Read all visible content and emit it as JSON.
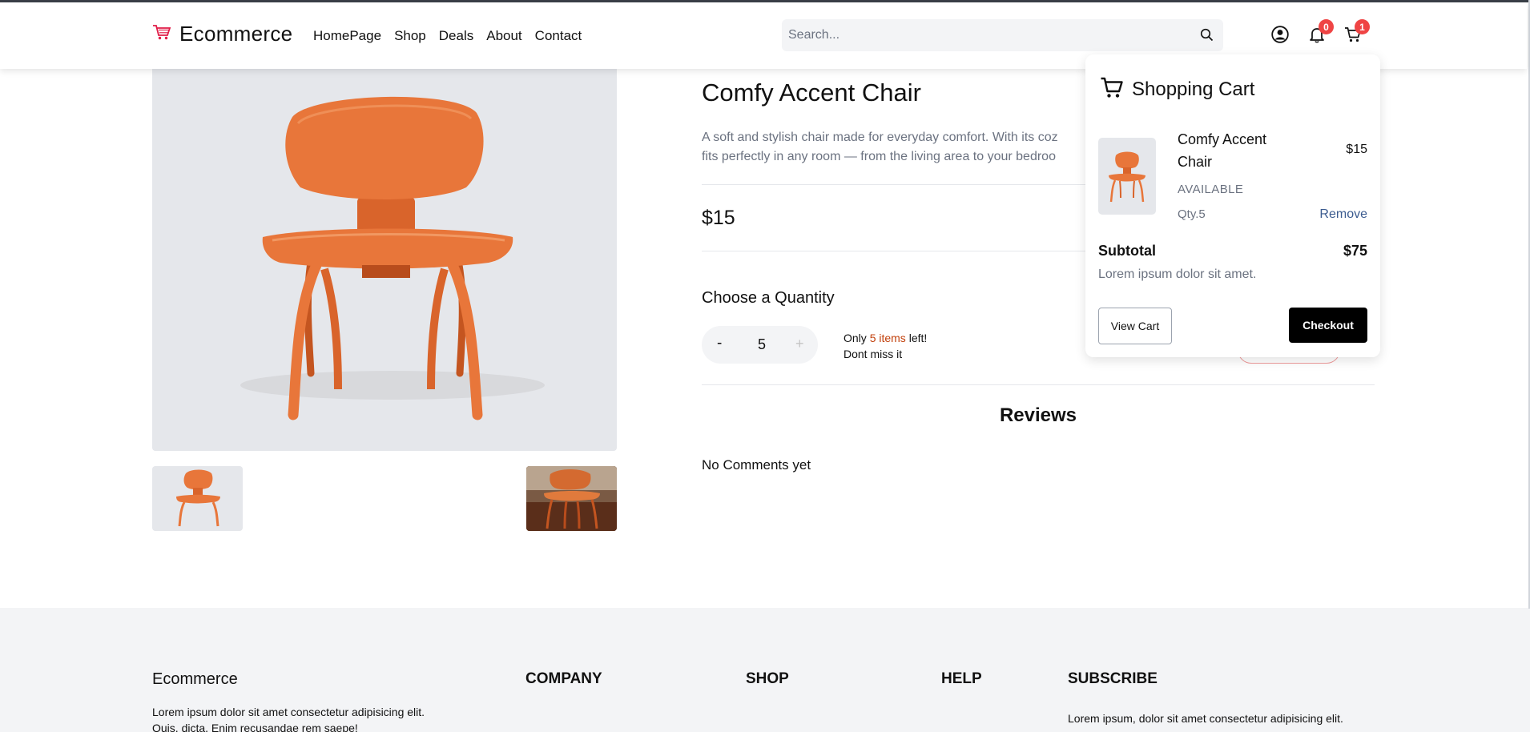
{
  "header": {
    "brand": "Ecommerce",
    "nav": [
      "HomePage",
      "Shop",
      "Deals",
      "About",
      "Contact"
    ],
    "search_placeholder": "Search...",
    "notifications_count": "0",
    "cart_count": "1"
  },
  "product": {
    "title": "Comfy Accent Chair",
    "description_line1": "A soft and stylish chair made for everyday comfort. With its coz",
    "description_line2": "fits perfectly in any room — from the living area to your bedroo",
    "price": "$15",
    "quantity_label": "Choose a Quantity",
    "quantity_minus": "-",
    "quantity_value": "5",
    "quantity_plus": "+",
    "stock_prefix": "Only ",
    "stock_highlight": "5 items",
    "stock_suffix": " left!",
    "stock_line2": "Dont miss it"
  },
  "reviews": {
    "title": "Reviews",
    "empty": "No Comments yet"
  },
  "cart": {
    "title": "Shopping Cart",
    "item": {
      "name": "Comfy Accent Chair",
      "price": "$15",
      "status": "AVAILABLE",
      "qty": "Qty.5",
      "remove": "Remove"
    },
    "subtotal_label": "Subtotal",
    "subtotal_value": "$75",
    "note": "Lorem ipsum dolor sit amet.",
    "view_cart": "View Cart",
    "checkout": "Checkout"
  },
  "footer": {
    "brand": "Ecommerce",
    "text_line1": "Lorem ipsum dolor sit amet consectetur adipisicing elit.",
    "text_line2": "Quis, dicta. Enim recusandae rem saepe!",
    "columns": [
      "COMPANY",
      "SHOP",
      "HELP",
      "SUBSCRIBE"
    ],
    "subscribe_text": "Lorem ipsum, dolor sit amet consectetur adipisicing elit."
  },
  "colors": {
    "accent_red": "#ef4444",
    "stock_highlight": "#c2410c",
    "link_blue": "#3b5b8f",
    "chair_orange": "#e8763a"
  },
  "icons": [
    "cart-logo-icon",
    "search-icon",
    "user-icon",
    "bell-icon",
    "cart-icon"
  ]
}
